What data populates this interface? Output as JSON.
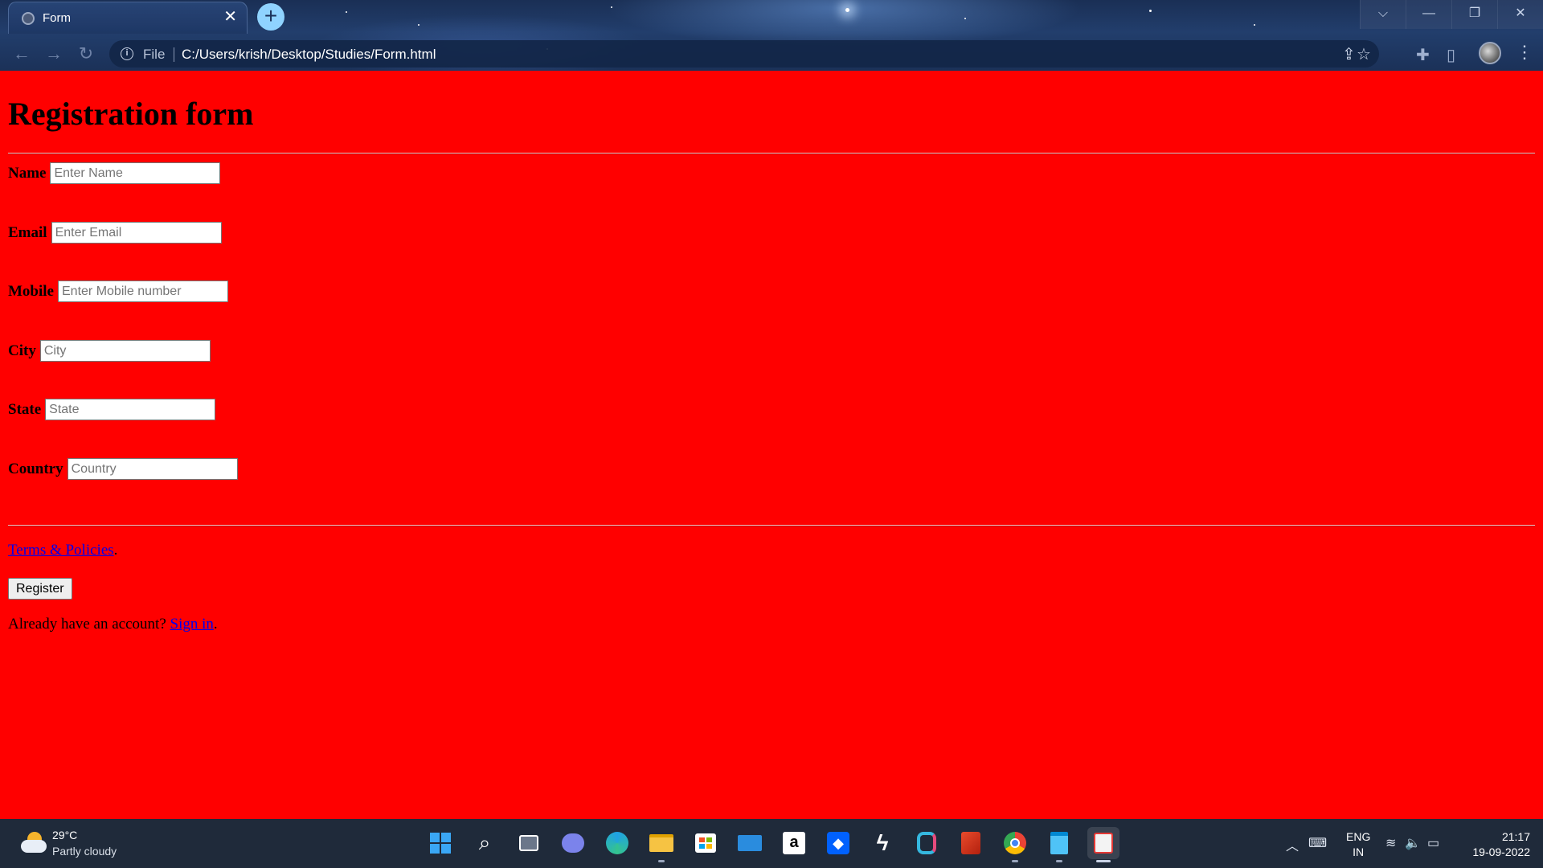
{
  "browser": {
    "tab_title": "Form",
    "tab_close": "✕",
    "new_tab": "+",
    "address": {
      "scheme_label": "File",
      "url": "C:/Users/krish/Desktop/Studies/Form.html"
    },
    "window_controls": [
      "⌵",
      "—",
      "❐",
      "✕"
    ]
  },
  "page": {
    "heading": "Registration form",
    "fields": [
      {
        "label": "Name",
        "placeholder": "Enter Name"
      },
      {
        "label": "Email",
        "placeholder": "Enter Email"
      },
      {
        "label": "Mobile",
        "placeholder": "Enter Mobile number"
      },
      {
        "label": "City",
        "placeholder": "City"
      },
      {
        "label": "State",
        "placeholder": "State"
      },
      {
        "label": "Country",
        "placeholder": "Country"
      }
    ],
    "terms_link": "Terms & Policies",
    "terms_suffix": ".",
    "register_button": "Register",
    "signin_prefix": "Already have an account? ",
    "signin_link": "Sign in",
    "signin_suffix": ".",
    "background_color": "#ff0000"
  },
  "taskbar": {
    "weather_temp": "29°C",
    "weather_desc": "Partly cloudy",
    "apps": [
      "start-icon",
      "search-icon",
      "task-view-icon",
      "teams-chat-icon",
      "edge-icon",
      "file-explorer-icon",
      "microsoft-store-icon",
      "mail-icon",
      "amazon-icon",
      "dropbox-icon",
      "app-icon",
      "visual-studio-icon",
      "office-icon",
      "chrome-icon",
      "notepad-icon",
      "snipping-tool-icon"
    ],
    "language_top": "ENG",
    "language_bottom": "IN",
    "time": "21:17",
    "date": "19-09-2022"
  }
}
